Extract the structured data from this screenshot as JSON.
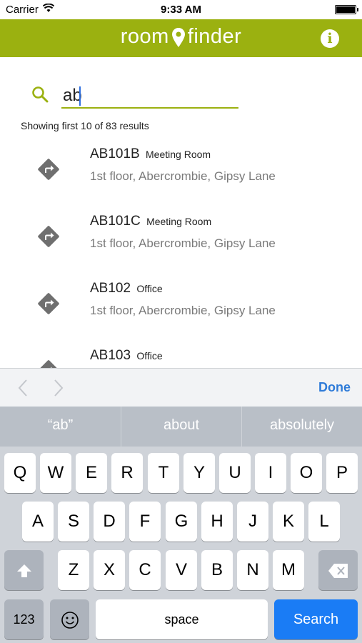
{
  "status_bar": {
    "carrier": "Carrier",
    "time": "9:33 AM"
  },
  "header": {
    "brand_left": "room",
    "brand_right": "finder",
    "info_label": "i",
    "color": "#9bb110"
  },
  "search": {
    "value": "ab",
    "placeholder": ""
  },
  "results_count": "Showing first 10 of 83 results",
  "results": [
    {
      "code": "AB101B",
      "type": "Meeting Room",
      "location": "1st floor, Abercrombie, Gipsy Lane"
    },
    {
      "code": "AB101C",
      "type": "Meeting Room",
      "location": "1st floor, Abercrombie, Gipsy Lane"
    },
    {
      "code": "AB102",
      "type": "Office",
      "location": "1st floor, Abercrombie, Gipsy Lane"
    },
    {
      "code": "AB103",
      "type": "Office",
      "location": ""
    }
  ],
  "accessory": {
    "done_label": "Done"
  },
  "keyboard": {
    "suggestions": [
      "“ab”",
      "about",
      "absolutely"
    ],
    "row1": [
      "Q",
      "W",
      "E",
      "R",
      "T",
      "Y",
      "U",
      "I",
      "O",
      "P"
    ],
    "row2": [
      "A",
      "S",
      "D",
      "F",
      "G",
      "H",
      "J",
      "K",
      "L"
    ],
    "row3": [
      "Z",
      "X",
      "C",
      "V",
      "B",
      "N",
      "M"
    ],
    "numbers_label": "123",
    "space_label": "space",
    "search_label": "Search"
  },
  "icons": {
    "search": "search-icon",
    "location_pin": "location-pin-icon",
    "info": "info-icon",
    "directions": "directions-icon",
    "prev": "chevron-left-icon",
    "next": "chevron-right-icon",
    "shift": "shift-icon",
    "delete": "delete-icon",
    "emoji": "emoji-icon"
  }
}
